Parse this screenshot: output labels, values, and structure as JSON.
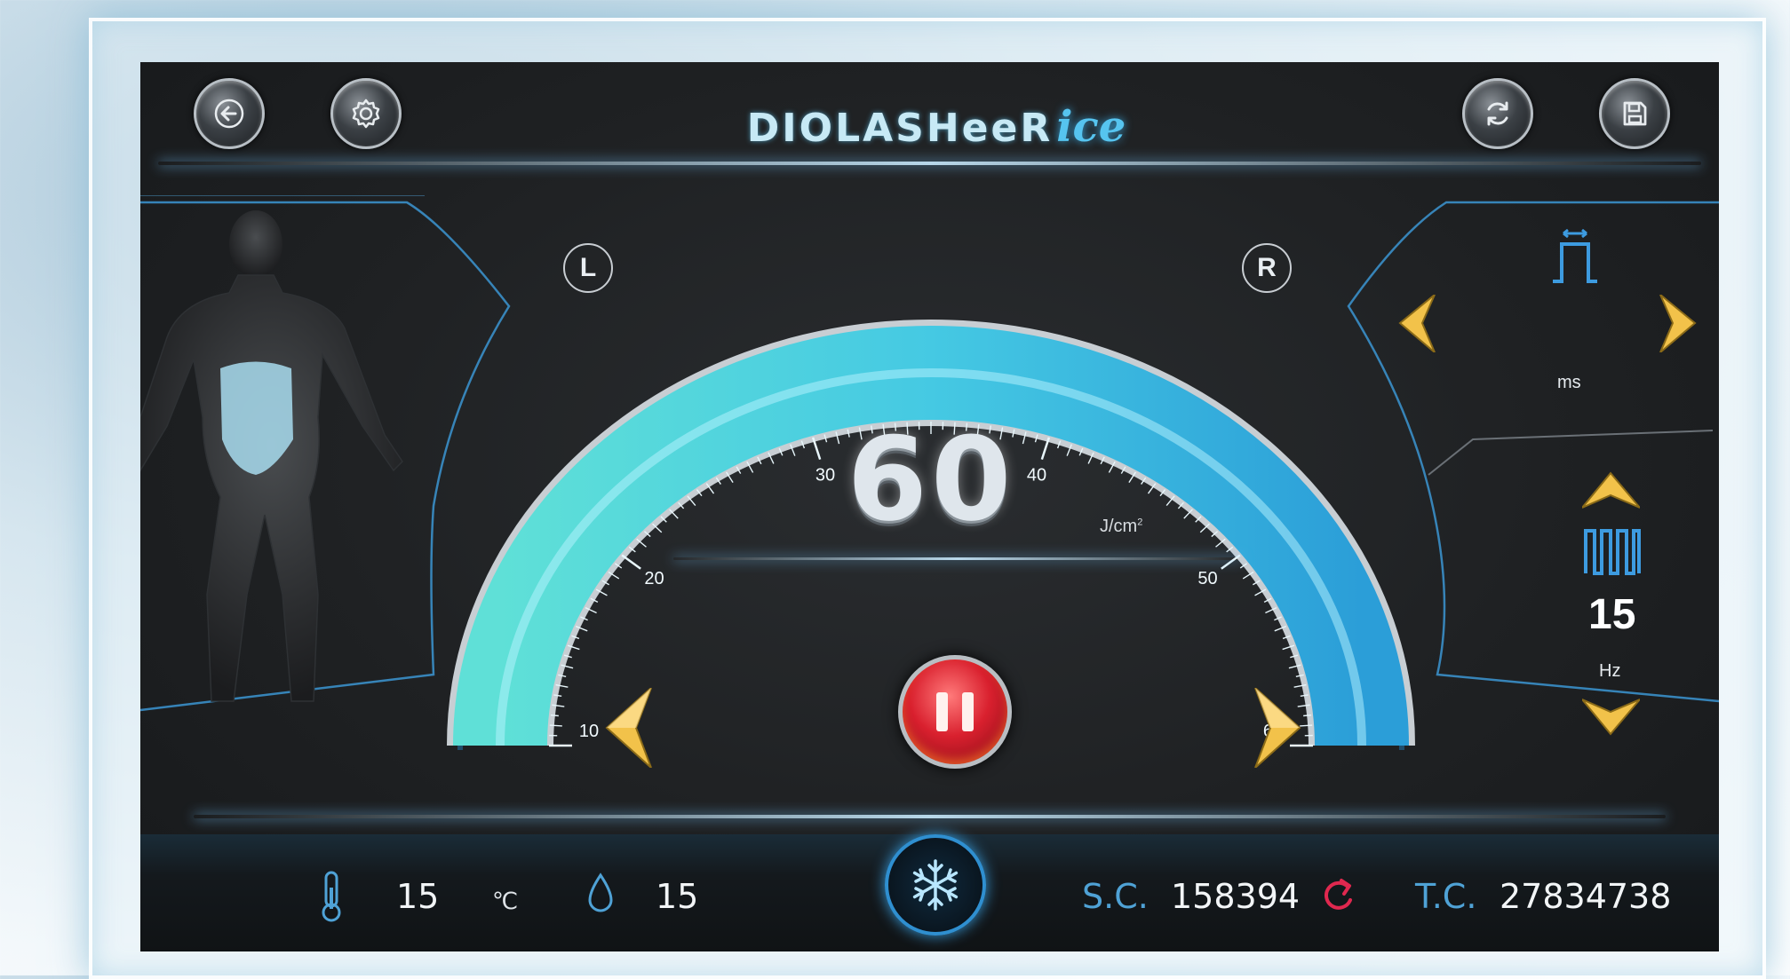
{
  "header": {
    "brand_main": "DIOLASHeeR",
    "brand_sub": "ice",
    "back_icon": "back-arrow-icon",
    "settings_icon": "gear-icon",
    "refresh_icon": "refresh-icon",
    "save_icon": "save-icon"
  },
  "handpiece": {
    "left_label": "L",
    "right_label": "R"
  },
  "fluence": {
    "value": "60",
    "unit": "J/cm",
    "unit_sup": "2",
    "scale_min": 10,
    "scale_max": 60,
    "level": 60,
    "ticks": [
      "10",
      "20",
      "30",
      "40",
      "50",
      "60"
    ]
  },
  "pulse_width": {
    "unit": "ms",
    "icon": "pulse-width-icon"
  },
  "frequency": {
    "value": "15",
    "unit": "Hz",
    "icon": "pulse-train-icon"
  },
  "status": {
    "temperature": "15",
    "temperature_unit": "℃",
    "water": "15",
    "sc_label": "S.C.",
    "sc_value": "158394",
    "tc_label": "T.C.",
    "tc_value": "27834738"
  },
  "colors": {
    "accent_blue": "#4fa2d6",
    "gauge_cyan": "#3fd4e6",
    "gold": "#f2c24a",
    "pause_red": "#d9202e",
    "reset_pink": "#e0284f"
  }
}
